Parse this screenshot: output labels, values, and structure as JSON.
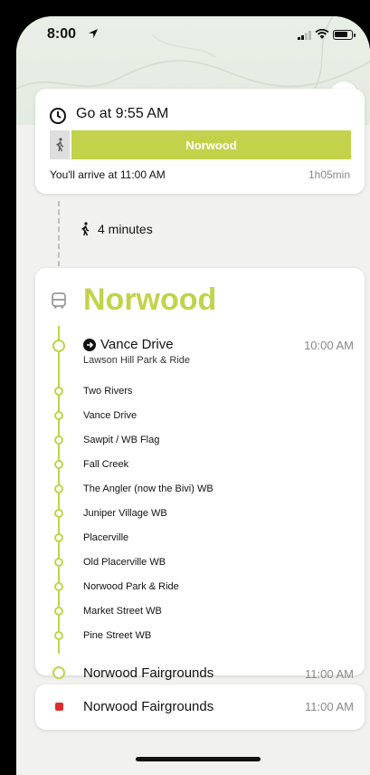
{
  "status_bar": {
    "time": "8:00"
  },
  "summary": {
    "depart": "Go at 9:55 AM",
    "route_label": "Norwood",
    "arrive": "You'll arrive at 11:00 AM",
    "duration": "1h05min"
  },
  "walk": {
    "label": "4 minutes"
  },
  "route": {
    "name": "Norwood",
    "first_stop": {
      "name": "Vance Drive",
      "sub": "Lawson Hill Park & Ride",
      "time": "10:00 AM"
    },
    "stops": [
      "Two Rivers",
      "Vance Drive",
      "Sawpit / WB Flag",
      "Fall Creek",
      "The Angler (now the Bivi) WB",
      "Juniper Village WB",
      "Placerville",
      "Old Placerville WB",
      "Norwood Park & Ride",
      "Market Street WB",
      "Pine Street WB"
    ],
    "last_stop": {
      "name": "Norwood Fairgrounds",
      "time": "11:00 AM"
    }
  },
  "destination": {
    "name": "Norwood Fairgrounds",
    "time": "11:00 AM"
  },
  "colors": {
    "route": "#c2d34b",
    "close": "#e53a2f",
    "destination": "#e02b2b"
  }
}
